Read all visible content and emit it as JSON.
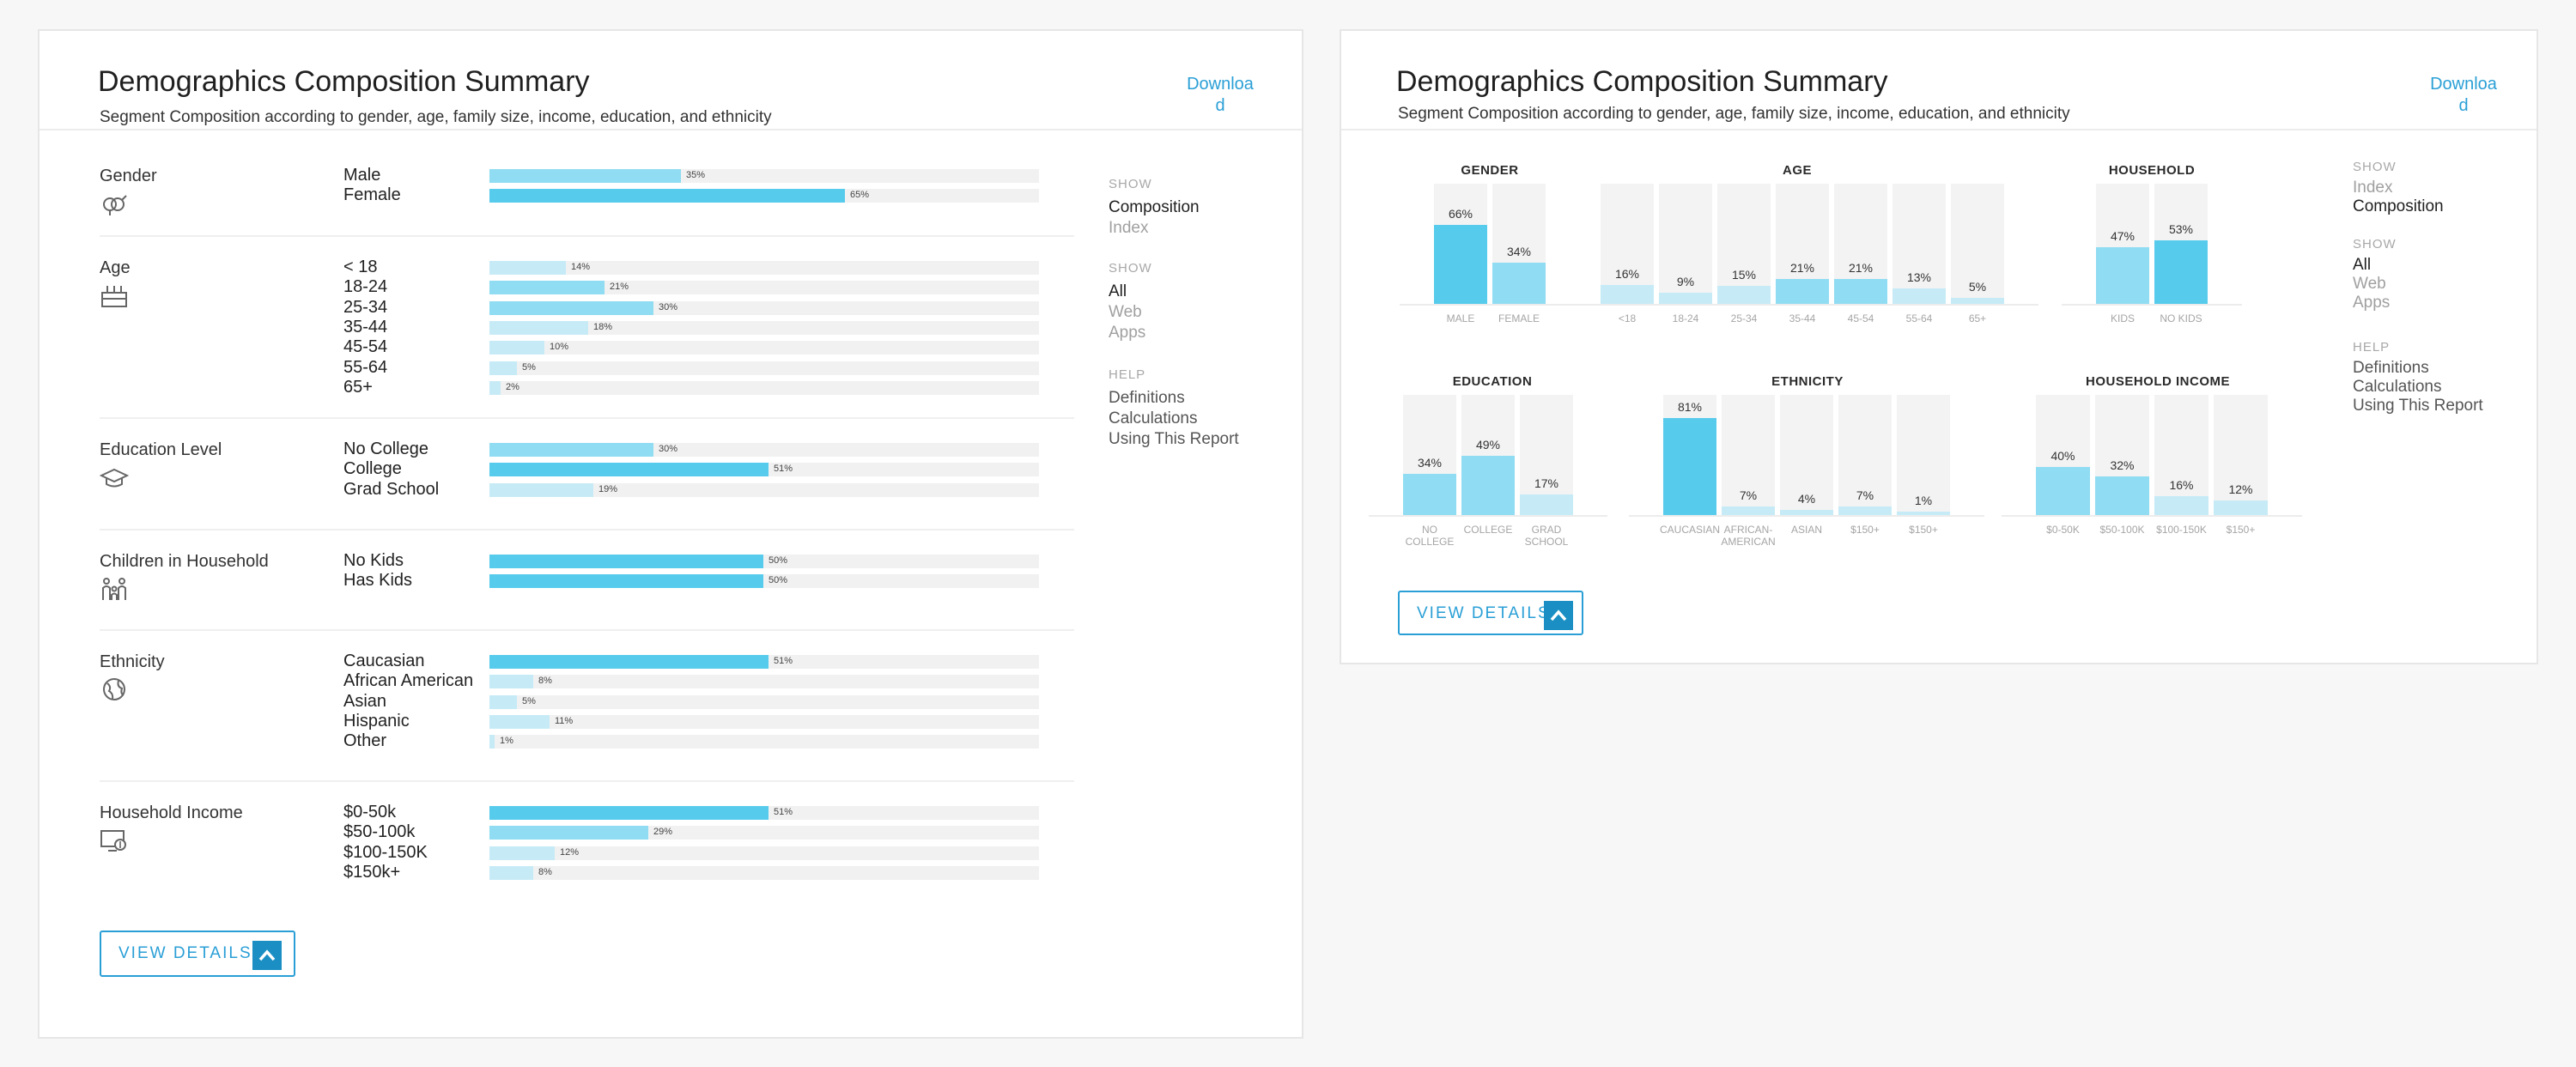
{
  "left_panel": {
    "title": "Demographics Composition Summary",
    "subtitle": "Segment Composition according to gender, age, family size, income, education, and ethnicity",
    "download": "Download",
    "download_line1": "Downloa",
    "download_line2": "d",
    "groups": [
      {
        "label": "Gender",
        "icon": "gender-icon",
        "rows": [
          {
            "label": "Male",
            "value": 35
          },
          {
            "label": "Female",
            "value": 65
          }
        ]
      },
      {
        "label": "Age",
        "icon": "cake-icon",
        "rows": [
          {
            "label": "< 18",
            "value": 14
          },
          {
            "label": "18-24",
            "value": 21
          },
          {
            "label": "25-34",
            "value": 30
          },
          {
            "label": "35-44",
            "value": 18
          },
          {
            "label": "45-54",
            "value": 10
          },
          {
            "label": "55-64",
            "value": 5
          },
          {
            "label": "65+",
            "value": 2
          }
        ]
      },
      {
        "label": "Education Level",
        "icon": "graduation-cap-icon",
        "rows": [
          {
            "label": "No College",
            "value": 30
          },
          {
            "label": "College",
            "value": 51
          },
          {
            "label": "Grad School",
            "value": 19
          }
        ]
      },
      {
        "label": "Children in Household",
        "icon": "family-icon",
        "rows": [
          {
            "label": "No Kids",
            "value": 50
          },
          {
            "label": "Has Kids",
            "value": 50
          }
        ]
      },
      {
        "label": "Ethnicity",
        "icon": "globe-icon",
        "rows": [
          {
            "label": "Caucasian",
            "value": 51
          },
          {
            "label": "African American",
            "value": 8
          },
          {
            "label": "Asian",
            "value": 5
          },
          {
            "label": "Hispanic",
            "value": 11
          },
          {
            "label": "Other",
            "value": 1
          }
        ]
      },
      {
        "label": "Household Income",
        "icon": "income-icon",
        "rows": [
          {
            "label": "$0-50k",
            "value": 51
          },
          {
            "label": "$50-100k",
            "value": 29
          },
          {
            "label": "$100-150K",
            "value": 12
          },
          {
            "label": "$150k+",
            "value": 8
          }
        ]
      }
    ],
    "sidebar": {
      "show1_head": "SHOW",
      "show1_items": [
        "Composition",
        "Index"
      ],
      "show2_head": "SHOW",
      "show2_items": [
        "All",
        "Web",
        "Apps"
      ],
      "help_head": "HELP",
      "help_items": [
        "Definitions",
        "Calculations",
        "Using This Report"
      ]
    },
    "view_details": "VIEW DETAILS"
  },
  "right_panel": {
    "title": "Demographics Composition Summary",
    "subtitle": "Segment Composition according to gender, age, family size, income, education, and ethnicity",
    "download_line1": "Downloa",
    "download_line2": "d",
    "sidebar": {
      "show1_head": "SHOW",
      "show1_items": [
        "Index",
        "Composition"
      ],
      "show2_head": "SHOW",
      "show2_items": [
        "All",
        "Web",
        "Apps"
      ],
      "help_head": "HELP",
      "help_items": [
        "Definitions",
        "Calculations",
        "Using This Report"
      ]
    },
    "view_details": "VIEW DETAILS"
  },
  "colors": {
    "accent": "#2a9fd6",
    "bar_strong": "#57cbec",
    "bar_mid": "#90dcf2",
    "bar_light": "#c6ebf7",
    "track": "#f1f1f1"
  },
  "chart_data": [
    {
      "type": "bar",
      "title": "Gender",
      "categories": [
        "Male",
        "Female"
      ],
      "values": [
        35,
        65
      ]
    },
    {
      "type": "bar",
      "title": "Age",
      "categories": [
        "< 18",
        "18-24",
        "25-34",
        "35-44",
        "45-54",
        "55-64",
        "65+"
      ],
      "values": [
        14,
        21,
        30,
        18,
        10,
        5,
        2
      ]
    },
    {
      "type": "bar",
      "title": "Education Level",
      "categories": [
        "No College",
        "College",
        "Grad School"
      ],
      "values": [
        30,
        51,
        19
      ]
    },
    {
      "type": "bar",
      "title": "Children in Household",
      "categories": [
        "No Kids",
        "Has Kids"
      ],
      "values": [
        50,
        50
      ]
    },
    {
      "type": "bar",
      "title": "Ethnicity",
      "categories": [
        "Caucasian",
        "African American",
        "Asian",
        "Hispanic",
        "Other"
      ],
      "values": [
        51,
        8,
        5,
        11,
        1
      ]
    },
    {
      "type": "bar",
      "title": "Household Income",
      "categories": [
        "$0-50k",
        "$50-100k",
        "$100-150K",
        "$150k+"
      ],
      "values": [
        51,
        29,
        12,
        8
      ]
    },
    {
      "type": "bar",
      "title": "GENDER",
      "categories": [
        "MALE",
        "FEMALE"
      ],
      "values": [
        66,
        34
      ]
    },
    {
      "type": "bar",
      "title": "AGE",
      "categories": [
        "<18",
        "18-24",
        "25-34",
        "35-44",
        "45-54",
        "55-64",
        "65+"
      ],
      "values": [
        16,
        9,
        15,
        21,
        21,
        13,
        5
      ]
    },
    {
      "type": "bar",
      "title": "HOUSEHOLD",
      "categories": [
        "KIDS",
        "NO KIDS"
      ],
      "values": [
        47,
        53
      ]
    },
    {
      "type": "bar",
      "title": "EDUCATION",
      "categories": [
        "NO COLLEGE",
        "COLLEGE",
        "GRAD SCHOOL"
      ],
      "values": [
        34,
        49,
        17
      ]
    },
    {
      "type": "bar",
      "title": "ETHNICITY",
      "categories": [
        "CAUCASIAN",
        "AFRICAN-AMERICAN",
        "ASIAN",
        "$150+",
        "$150+"
      ],
      "values": [
        81,
        7,
        4,
        7,
        1
      ]
    },
    {
      "type": "bar",
      "title": "HOUSEHOLD INCOME",
      "categories": [
        "$0-50K",
        "$50-100K",
        "$100-150K",
        "$150+"
      ],
      "values": [
        40,
        32,
        16,
        12
      ]
    }
  ]
}
